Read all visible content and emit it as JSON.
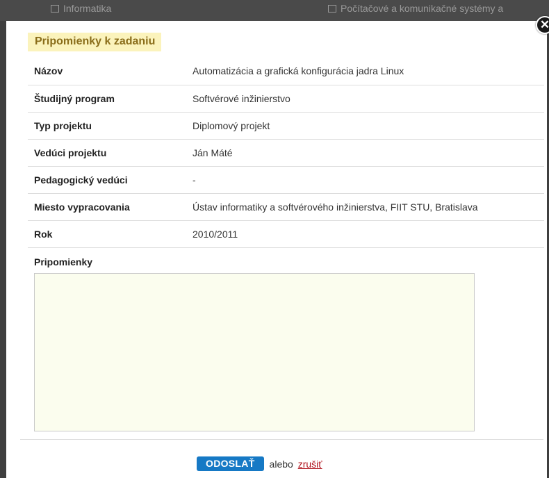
{
  "background": {
    "items": [
      {
        "label": "Informatika"
      },
      {
        "label": "Počítačové a komunikačné systémy a"
      }
    ]
  },
  "modal": {
    "title": "Pripomienky k zadaniu",
    "close_icon": "close-icon",
    "rows": [
      {
        "label": "Názov",
        "value": "Automatizácia a grafická konfigurácia jadra Linux"
      },
      {
        "label": "Študijný program",
        "value": "Softvérové inžinierstvo"
      },
      {
        "label": "Typ projektu",
        "value": "Diplomový projekt"
      },
      {
        "label": "Vedúci projektu",
        "value": "Ján Máté"
      },
      {
        "label": "Pedagogický vedúci",
        "value": "-"
      },
      {
        "label": "Miesto vypracovania",
        "value": "Ústav informatiky a softvérového inžinierstva, FIIT STU, Bratislava"
      },
      {
        "label": "Rok",
        "value": "2010/2011"
      }
    ],
    "comments": {
      "label": "Pripomienky",
      "value": ""
    },
    "footer": {
      "send_label": "ODOSLAŤ",
      "or_text": "alebo",
      "cancel_label": "zrušiť"
    }
  },
  "colors": {
    "title_bg": "#fbf3bc",
    "title_text": "#8a6d1a",
    "button_blue": "#1679c5",
    "link_red": "#b0121b",
    "textarea_bg": "#fbfdee"
  }
}
